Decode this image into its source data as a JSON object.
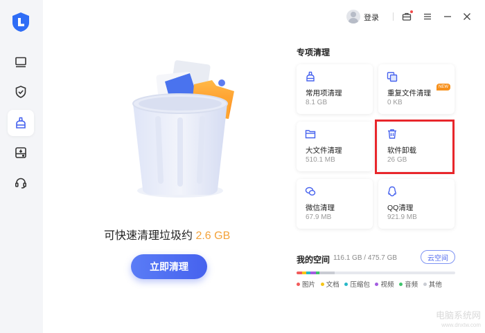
{
  "titlebar": {
    "login_label": "登录",
    "icons": [
      "avatar-icon",
      "toolbox-icon",
      "menu-icon",
      "minimize-icon",
      "close-icon"
    ]
  },
  "sidebar": {
    "items": [
      {
        "name": "computer-icon",
        "active": false
      },
      {
        "name": "shield-icon",
        "active": false
      },
      {
        "name": "broom-clean-icon",
        "active": true
      },
      {
        "name": "drive-icon",
        "active": false
      },
      {
        "name": "headset-icon",
        "active": false
      }
    ]
  },
  "hero": {
    "text_prefix": "可快速清理垃圾约 ",
    "size": "2.6 GB",
    "button_label": "立即清理"
  },
  "special": {
    "title": "专项清理",
    "cards": [
      {
        "icon": "broom-icon",
        "name": "常用项清理",
        "size": "8.1 GB"
      },
      {
        "icon": "duplicate-files-icon",
        "name": "重复文件清理",
        "size": "0 KB",
        "badge": "NEW"
      },
      {
        "icon": "folder-icon",
        "name": "大文件清理",
        "size": "510.1 MB"
      },
      {
        "icon": "trash-icon",
        "name": "软件卸载",
        "size": "26 GB"
      },
      {
        "icon": "wechat-icon",
        "name": "微信清理",
        "size": "67.9 MB"
      },
      {
        "icon": "qq-icon",
        "name": "QQ清理",
        "size": "921.9 MB"
      }
    ]
  },
  "space": {
    "title": "我的空间",
    "value": "116.1 GB / 475.7 GB",
    "cloud_button": "云空间",
    "legend": [
      {
        "label": "图片",
        "color": "#f25a5a"
      },
      {
        "label": "文档",
        "color": "#f5c518"
      },
      {
        "label": "压缩包",
        "color": "#28b8c8"
      },
      {
        "label": "视频",
        "color": "#a25ce0"
      },
      {
        "label": "音频",
        "color": "#3fc46c"
      },
      {
        "label": "其他",
        "color": "#c9ccd3"
      }
    ]
  },
  "watermark": {
    "line1": "电脑系统网",
    "line2": "www.dnxtw.com"
  },
  "colors": {
    "accent": "#4662ee",
    "size_highlight": "#f3a23a",
    "selection_box": "#e8262b"
  }
}
